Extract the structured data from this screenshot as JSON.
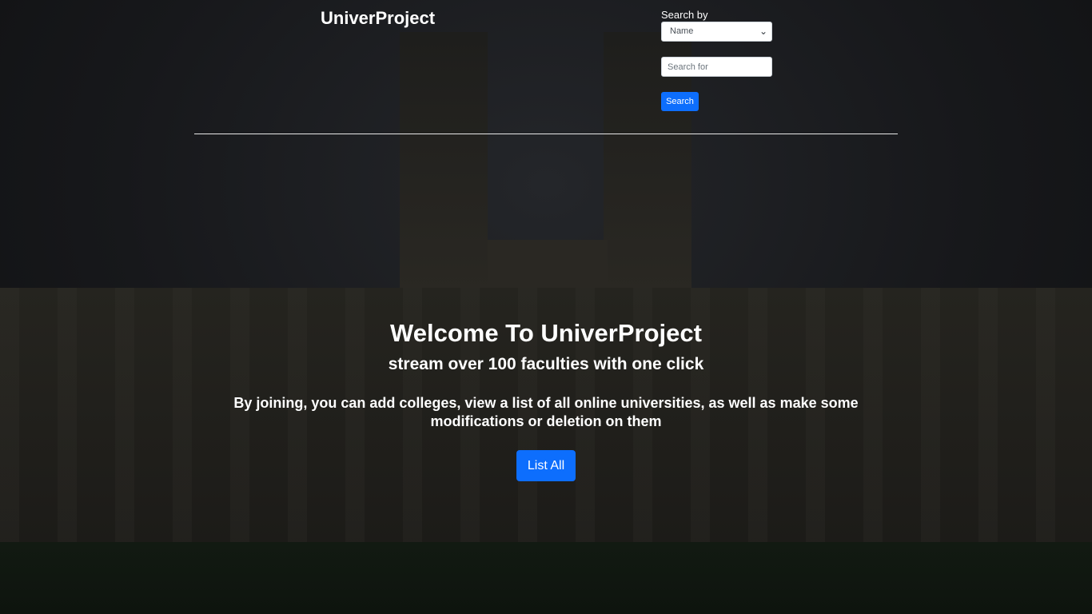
{
  "header": {
    "brand": "UniverProject"
  },
  "search": {
    "label": "Search by",
    "selected_option": "Name",
    "placeholder": "Search for",
    "button_label": "Search"
  },
  "hero": {
    "title": "Welcome To UniverProject",
    "subtitle": "stream over 100 faculties with one click",
    "description": "By joining, you can add colleges, view a list of all online universities, as well as make some modifications or deletion on them",
    "button_label": "List All"
  },
  "colors": {
    "primary": "#0d6efd",
    "text": "#ffffff",
    "background": "#141517"
  }
}
